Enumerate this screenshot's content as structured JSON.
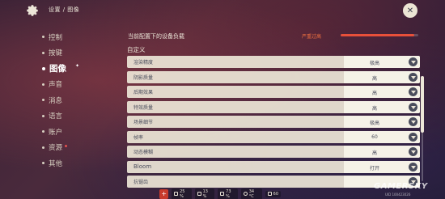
{
  "header": {
    "breadcrumb": "设置 / 图像",
    "close_label": "✕"
  },
  "sidebar": {
    "items": [
      {
        "label": "控制"
      },
      {
        "label": "按键"
      },
      {
        "label": "图像",
        "active": true
      },
      {
        "label": "声音"
      },
      {
        "label": "消息"
      },
      {
        "label": "语言"
      },
      {
        "label": "账户"
      },
      {
        "label": "资源",
        "badge": true
      },
      {
        "label": "其他"
      }
    ]
  },
  "main": {
    "load_title": "当前配置下的设备负载",
    "load_status": "严重过高",
    "load_fraction": 0.95,
    "load_color": "#e8503a",
    "section_title": "自定义",
    "settings": [
      {
        "label": "渲染精度",
        "value": "极高"
      },
      {
        "label": "阴影质量",
        "value": "高"
      },
      {
        "label": "后期效果",
        "value": "高"
      },
      {
        "label": "特效质量",
        "value": "高"
      },
      {
        "label": "场景细节",
        "value": "极高"
      },
      {
        "label": "帧率",
        "value": "60"
      },
      {
        "label": "动态模糊",
        "value": "高"
      },
      {
        "label": "Bloom",
        "value": "打开"
      },
      {
        "label": "抗锯齿",
        "value": ""
      }
    ],
    "scroll_fraction": 0.0
  },
  "statusbar": {
    "items": [
      {
        "icon": "cpu-icon",
        "text": "25 %"
      },
      {
        "icon": "memory-icon",
        "text": "13 %"
      },
      {
        "icon": "battery-icon",
        "text": "73 %"
      },
      {
        "icon": "temperature-icon",
        "text": "34 °C"
      },
      {
        "icon": "fps-icon",
        "text": "60"
      }
    ]
  },
  "watermark": {
    "text": "GAMERSKY",
    "sub": "UID 100423026"
  }
}
